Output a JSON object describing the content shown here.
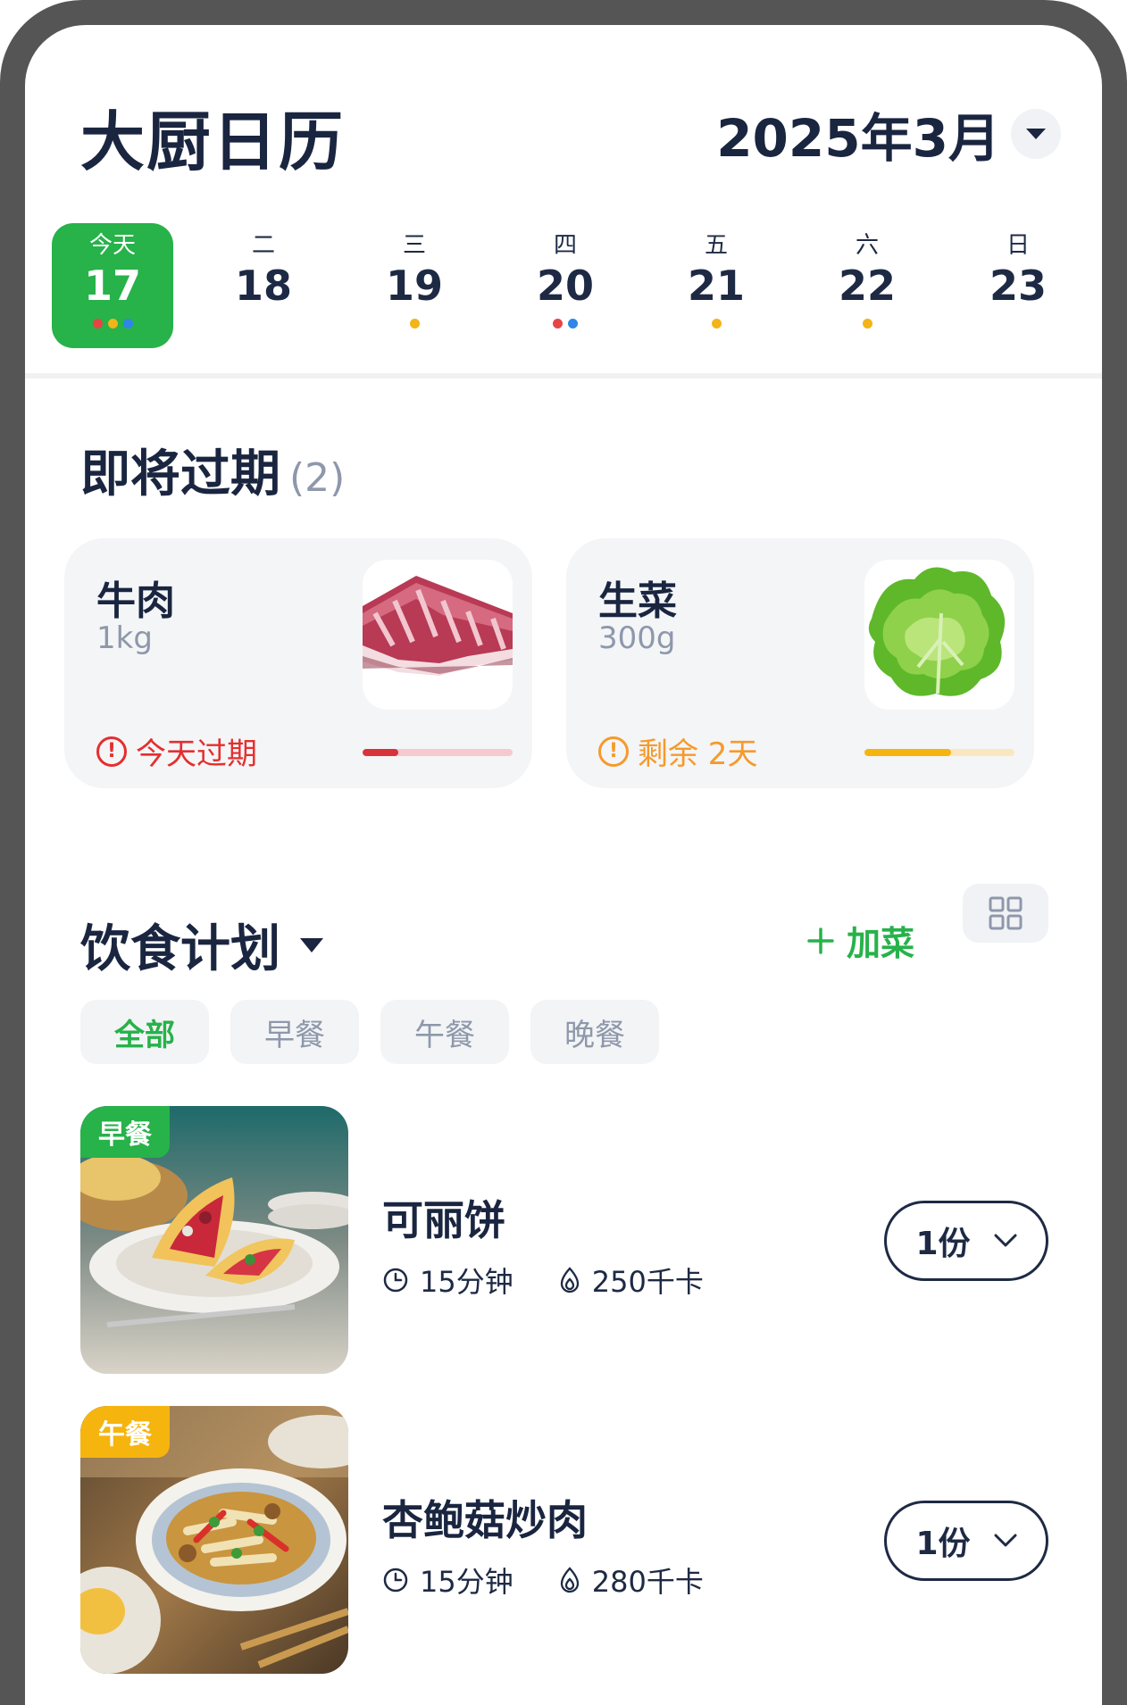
{
  "header": {
    "title": "大厨日历",
    "month": "2025年3月"
  },
  "week": [
    {
      "dow": "今天",
      "day": "17",
      "active": true,
      "dots": [
        "#e64545",
        "#f2b418",
        "#2f86e8"
      ]
    },
    {
      "dow": "二",
      "day": "18",
      "active": false,
      "dots": []
    },
    {
      "dow": "三",
      "day": "19",
      "active": false,
      "dots": [
        "#f2b418"
      ]
    },
    {
      "dow": "四",
      "day": "20",
      "active": false,
      "dots": [
        "#e64545",
        "#2f86e8"
      ]
    },
    {
      "dow": "五",
      "day": "21",
      "active": false,
      "dots": [
        "#f2b418"
      ]
    },
    {
      "dow": "六",
      "day": "22",
      "active": false,
      "dots": [
        "#f2b418"
      ]
    },
    {
      "dow": "日",
      "day": "23",
      "active": false,
      "dots": []
    }
  ],
  "expiring": {
    "title": "即将过期",
    "count": "(2)",
    "items": [
      {
        "name": "牛肉",
        "qty": "1kg",
        "status": "今天过期",
        "status_color": "#e52e2e",
        "freshness": 0.24,
        "bar_color": "#d8333a",
        "track_color": "#f6c9cf",
        "image": "beef-photo"
      },
      {
        "name": "生菜",
        "qty": "300g",
        "status": "剩余 2天",
        "status_color": "#f59a2b",
        "freshness": 0.58,
        "bar_color": "#f6b40f",
        "track_color": "#fbe7bf",
        "image": "lettuce-photo"
      }
    ]
  },
  "plan": {
    "title": "饮食计划",
    "add_label": "加菜",
    "filters": [
      "全部",
      "早餐",
      "午餐",
      "晚餐"
    ],
    "active_filter": 0,
    "meals": [
      {
        "tag": "早餐",
        "tag_color": "#27b24a",
        "name": "可丽饼",
        "time": "15分钟",
        "calories": "250千卡",
        "portion": "1份"
      },
      {
        "tag": "午餐",
        "tag_color": "#f6b40f",
        "name": "杏鲍菇炒肉",
        "time": "15分钟",
        "calories": "280千卡",
        "portion": "1份"
      }
    ]
  },
  "colors": {
    "accent": "#27b24a",
    "text": "#1a2540",
    "muted": "#8e98ab"
  }
}
